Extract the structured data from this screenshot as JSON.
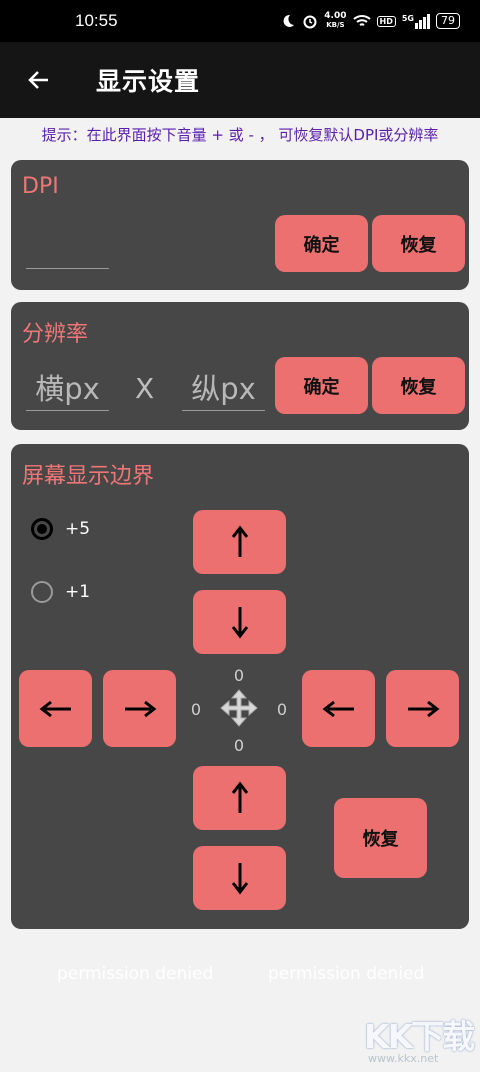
{
  "status_bar": {
    "time": "10:55",
    "net_speed": "4.00",
    "net_unit": "KB/S",
    "hd": "HD",
    "signal": "5G",
    "battery": "79"
  },
  "app_bar": {
    "title": "显示设置"
  },
  "hint": "提示：在此界面按下音量 + 或 - ， 可恢复默认DPI或分辨率",
  "dpi_card": {
    "title": "DPI",
    "input_value": "",
    "confirm": "确定",
    "restore": "恢复"
  },
  "resolution_card": {
    "title": "分辨率",
    "width_placeholder": "横px",
    "separator": "X",
    "height_placeholder": "纵px",
    "confirm": "确定",
    "restore": "恢复"
  },
  "border_card": {
    "title": "屏幕显示边界",
    "step_options": [
      {
        "label": "+5",
        "selected": true
      },
      {
        "label": "+1",
        "selected": false
      }
    ],
    "top_value": "0",
    "left_value": "0",
    "right_value": "0",
    "bottom_value": "0",
    "restore": "恢复"
  },
  "footer": {
    "left": "permission denied",
    "right": "permission denied"
  },
  "watermark": {
    "text": "KK下载",
    "url": "www.kkx.net"
  }
}
